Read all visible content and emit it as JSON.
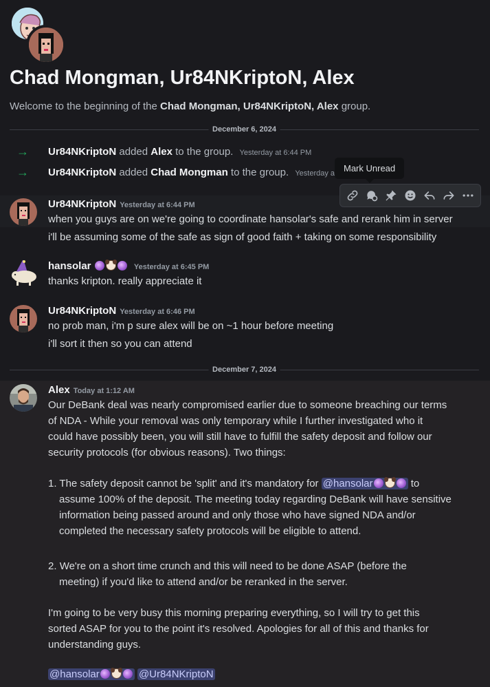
{
  "header": {
    "title": "Chad Mongman, Ur84NKriptoN, Alex",
    "welcome_prefix": "Welcome to the beginning of the",
    "welcome_group": "Chad Mongman, Ur84NKriptoN, Alex",
    "welcome_suffix": "group."
  },
  "dividers": {
    "first": "December 6, 2024",
    "second": "December 7, 2024"
  },
  "system": [
    {
      "actor": "Ur84NKriptoN",
      "verb": "added",
      "target": "Alex",
      "rest": "to the group.",
      "time": "Yesterday at 6:44 PM"
    },
    {
      "actor": "Ur84NKriptoN",
      "verb": "added",
      "target": "Chad Mongman",
      "rest": "to the group.",
      "time": "Yesterday at"
    }
  ],
  "tooltip": "Mark Unread",
  "toolbar": {
    "icons": [
      "link-icon",
      "thread-icon",
      "pin-icon",
      "add-reaction-icon",
      "reply-icon",
      "forward-icon",
      "more-icon"
    ]
  },
  "messages": [
    {
      "user": "Ur84NKriptoN",
      "time": "Yesterday at 6:44 PM",
      "lines": [
        "when you guys are on we're going to coordinate hansolar's safe and rerank him in server",
        "i'll be assuming some of the safe as sign of good faith + taking on some responsibility"
      ]
    },
    {
      "user": "hansolar",
      "time": "Yesterday at 6:45 PM",
      "lines": [
        "thanks kripton. really appreciate it"
      ]
    },
    {
      "user": "Ur84NKriptoN",
      "time": "Yesterday at 6:46 PM",
      "lines": [
        "no prob man, i'm p sure alex will be on ~1 hour before meeting",
        "i'll sort it then so you can attend"
      ]
    }
  ],
  "alex": {
    "user": "Alex",
    "time": "Today at 1:12 AM",
    "intro": [
      "Our DeBank deal was nearly compromised earlier due to someone breaching our terms",
      "of NDA - While your removal was only temporary while I further investigated who it",
      "could have possibly been, you will still have to fulfill the safety deposit and follow our",
      "security protocols (for obvious reasons). Two things:"
    ],
    "item1_num": "1.",
    "item1_first": "The safety deposit cannot be 'split' and it's mandatory for",
    "item1_mention": "@hansolar",
    "item1_after": "to",
    "item1_lines": [
      "assume 100% of the deposit. The meeting today regarding DeBank will have sensitive",
      "information being passed around and only those who have signed NDA and/or",
      "completed the necessary safety protocols will be eligible to attend."
    ],
    "item2_num": "2.",
    "item2_lines": [
      "We're on a short time crunch and this will need to be done ASAP (before the",
      "meeting) if you'd like to attend and/or be reranked in the server."
    ],
    "outro": [
      "I'm going to be very busy this morning preparing everything, so I will try to get this",
      "sorted ASAP for you to the point it's resolved. Apologies for all of this and thanks for",
      "understanding guys."
    ],
    "mention1": "@hansolar",
    "mention2": "@Ur84NKriptoN"
  },
  "colors": {
    "background": "#1a1a1e",
    "mention_bg": "#3c4270",
    "system_arrow": "#23a55a"
  }
}
